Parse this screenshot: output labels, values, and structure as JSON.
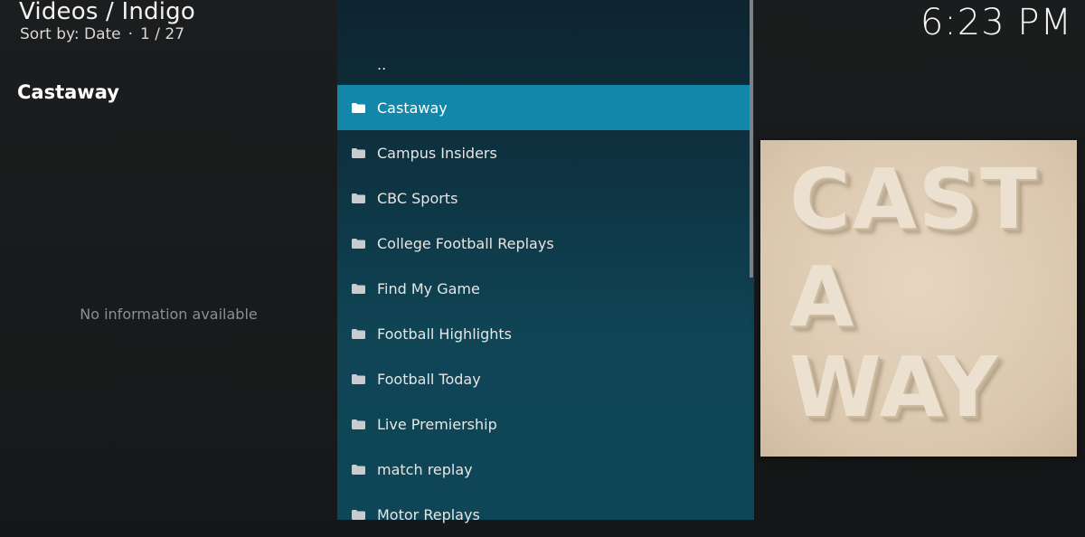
{
  "header": {
    "breadcrumb": "Videos / Indigo",
    "sort_label": "Sort by: Date",
    "separator": "·",
    "position": "1 / 27"
  },
  "clock": "6:23 PM",
  "info_panel": {
    "selected_title": "Castaway",
    "no_info": "No information available"
  },
  "list": {
    "parent": "..",
    "items": [
      {
        "label": "Castaway",
        "selected": true
      },
      {
        "label": "Campus Insiders"
      },
      {
        "label": "CBC Sports"
      },
      {
        "label": "College Football Replays"
      },
      {
        "label": "Find My Game"
      },
      {
        "label": "Football Highlights"
      },
      {
        "label": "Football Today"
      },
      {
        "label": "Live Premiership"
      },
      {
        "label": "match replay"
      },
      {
        "label": "Motor Replays"
      }
    ]
  },
  "poster": {
    "lines": [
      "CAST",
      "A",
      "WAY"
    ]
  },
  "colors": {
    "selected_row": "#1287aa",
    "list_bg": "#0e3a4a",
    "poster_bg": "#dac7ae"
  }
}
